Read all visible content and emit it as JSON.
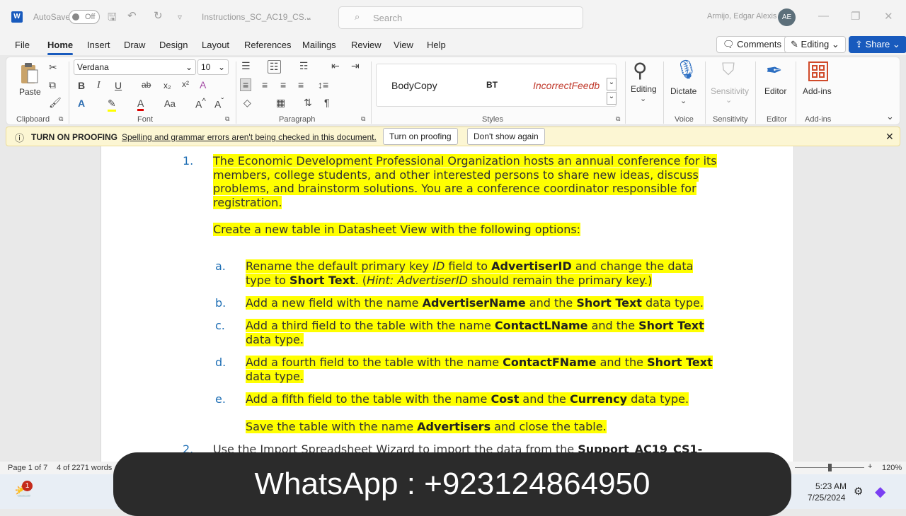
{
  "titlebar": {
    "autosave_label": "AutoSave",
    "autosave_state": "Off",
    "doc_title": "Instructions_SC_AC19_CS...",
    "search_placeholder": "Search",
    "user_name": "Armijo, Edgar Alexis",
    "user_initials": "AE"
  },
  "menu": {
    "tabs": [
      "File",
      "Home",
      "Insert",
      "Draw",
      "Design",
      "Layout",
      "References",
      "Mailings",
      "Review",
      "View",
      "Help"
    ],
    "active": "Home",
    "comments": "Comments",
    "editing": "Editing",
    "share": "Share"
  },
  "ribbon": {
    "paste": "Paste",
    "clipboard": "Clipboard",
    "font_name": "Verdana",
    "font_size": "10",
    "font": "Font",
    "paragraph": "Paragraph",
    "styles": "Styles",
    "style_items": [
      "BodyCopy",
      "BT",
      "IncorrectFeedb"
    ],
    "editing": "Editing",
    "dictate": "Dictate",
    "voice": "Voice",
    "sensitivity": "Sensitivity",
    "sensitivity_group": "Sensitivity",
    "editor": "Editor",
    "editor_group": "Editor",
    "addins": "Add-ins",
    "addins_group": "Add-ins"
  },
  "proofing": {
    "title": "TURN ON PROOFING",
    "message": "Spelling and grammar errors aren't being checked in this document.",
    "btn_on": "Turn on proofing",
    "btn_dont": "Don't show again"
  },
  "document": {
    "item1_num": "1.",
    "item1_lines": [
      "The Economic Development Professional Organization hosts an annual conference for its",
      "members, college students, and other interested persons to share new ideas, discuss",
      "problems, and brainstorm solutions. You are a conference coordinator responsible for",
      "registration."
    ],
    "item1_create": "Create a new table in Datasheet View with the following options:",
    "sub_a": "a.",
    "sub_b": "b.",
    "sub_c": "c.",
    "sub_d": "d.",
    "sub_e": "e.",
    "save_line_1": "Save the table with the name ",
    "save_bold": "Advertisers",
    "save_line_2": " and close the table.",
    "item2_num": "2.",
    "item2_text": "Use the Import Spreadsheet Wizard to import the data from the ",
    "item2_bold": "Support_AC19_CS1-"
  },
  "status": {
    "page": "Page 1 of 7",
    "words": "4 of 2271 words",
    "zoom": "120%"
  },
  "taskbar": {
    "badge": "1",
    "time": "5:23 AM",
    "date": "7/25/2024"
  },
  "overlay": {
    "whatsapp": "WhatsApp : +923124864950"
  }
}
